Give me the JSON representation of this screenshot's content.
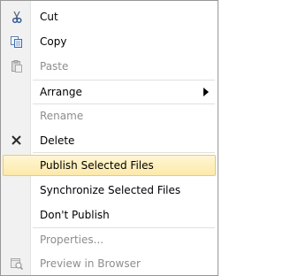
{
  "menu": {
    "items": [
      {
        "label": "Cut",
        "icon": "scissors-icon",
        "disabled": false
      },
      {
        "label": "Copy",
        "icon": "copy-icon",
        "disabled": false
      },
      {
        "label": "Paste",
        "icon": "paste-icon",
        "disabled": true
      },
      {
        "label": "Arrange",
        "has_submenu": true,
        "disabled": false
      },
      {
        "label": "Rename",
        "disabled": true
      },
      {
        "label": "Delete",
        "icon": "delete-x-icon",
        "disabled": false
      },
      {
        "label": "Publish Selected Files",
        "highlighted": true,
        "disabled": false
      },
      {
        "label": "Synchronize Selected Files",
        "disabled": false
      },
      {
        "label": "Don't Publish",
        "disabled": false
      },
      {
        "label": "Properties...",
        "disabled": true
      },
      {
        "label": "Preview in Browser",
        "icon": "preview-browser-icon",
        "disabled": true
      }
    ]
  },
  "colors": {
    "highlight_border": "#f2c96b",
    "highlight_fill": "#fde9a9",
    "disabled_text": "#8d8d8d"
  }
}
